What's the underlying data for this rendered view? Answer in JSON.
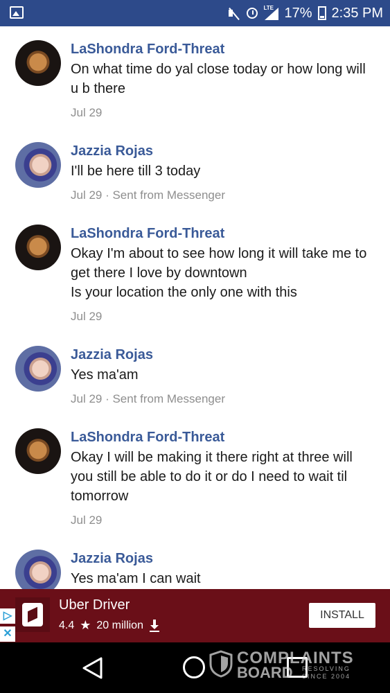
{
  "status_bar": {
    "lte": "LTE",
    "battery": "17%",
    "time": "2:35 PM"
  },
  "messages": [
    {
      "sender": "LaShondra Ford-Threat",
      "text": "On what time do yal close today or how long will u b there",
      "meta": "Jul 29",
      "avatar": "lashondra"
    },
    {
      "sender": "Jazzia Rojas",
      "text": "I'll be here till 3 today",
      "meta": "Jul 29 · Sent from Messenger",
      "avatar": "jazzia"
    },
    {
      "sender": "LaShondra Ford-Threat",
      "text": "Okay I'm about to see how long it will take me to get there I love by downtown\nIs your location the only one with this",
      "meta": "Jul 29",
      "avatar": "lashondra"
    },
    {
      "sender": "Jazzia Rojas",
      "text": "Yes ma'am",
      "meta": "Jul 29 · Sent from Messenger",
      "avatar": "jazzia"
    },
    {
      "sender": "LaShondra Ford-Threat",
      "text": "Okay I will be making it there right at three will you still be able to do it or do I need to wait til tomorrow",
      "meta": "Jul 29",
      "avatar": "lashondra"
    },
    {
      "sender": "Jazzia Rojas",
      "text": "Yes ma'am I can wait",
      "meta": "",
      "avatar": "jazzia"
    }
  ],
  "ad": {
    "title": "Uber Driver",
    "rating": "4.4",
    "installs": "20 million",
    "install_label": "INSTALL"
  },
  "watermark": {
    "line1": "COMPLAINTS",
    "line2": "BOARD",
    "line3": "RESOLVING SINCE 2004"
  }
}
